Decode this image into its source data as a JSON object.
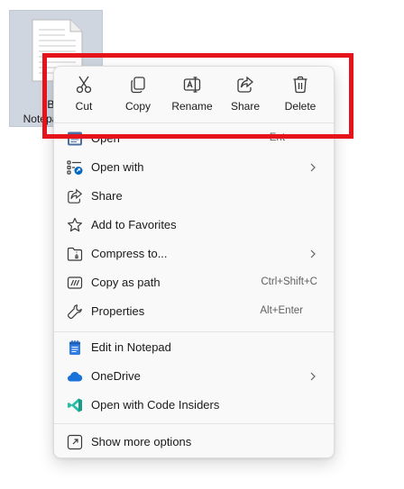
{
  "file": {
    "name_line1": "Brn",
    "name_line2": "Notepad"
  },
  "quick_actions": [
    {
      "label": "Cut",
      "icon": "scissors-icon"
    },
    {
      "label": "Copy",
      "icon": "copy-icon"
    },
    {
      "label": "Rename",
      "icon": "rename-icon"
    },
    {
      "label": "Share",
      "icon": "share-icon"
    },
    {
      "label": "Delete",
      "icon": "trash-icon"
    }
  ],
  "menu": {
    "items": [
      {
        "label": "Open",
        "shortcut": "Ent"
      },
      {
        "label": "Open with"
      },
      {
        "label": "Share"
      },
      {
        "label": "Add to Favorites"
      },
      {
        "label": "Compress to..."
      },
      {
        "label": "Copy as path",
        "shortcut": "Ctrl+Shift+C"
      },
      {
        "label": "Properties",
        "shortcut": "Alt+Enter"
      },
      {
        "label": "Edit in Notepad"
      },
      {
        "label": "OneDrive"
      },
      {
        "label": "Open with Code Insiders"
      },
      {
        "label": "Show more options"
      }
    ]
  },
  "colors": {
    "highlight": "#e5141b",
    "accent": "#0067c0",
    "onedrive": "#1a73d8",
    "vscode": "#24bfa5"
  }
}
